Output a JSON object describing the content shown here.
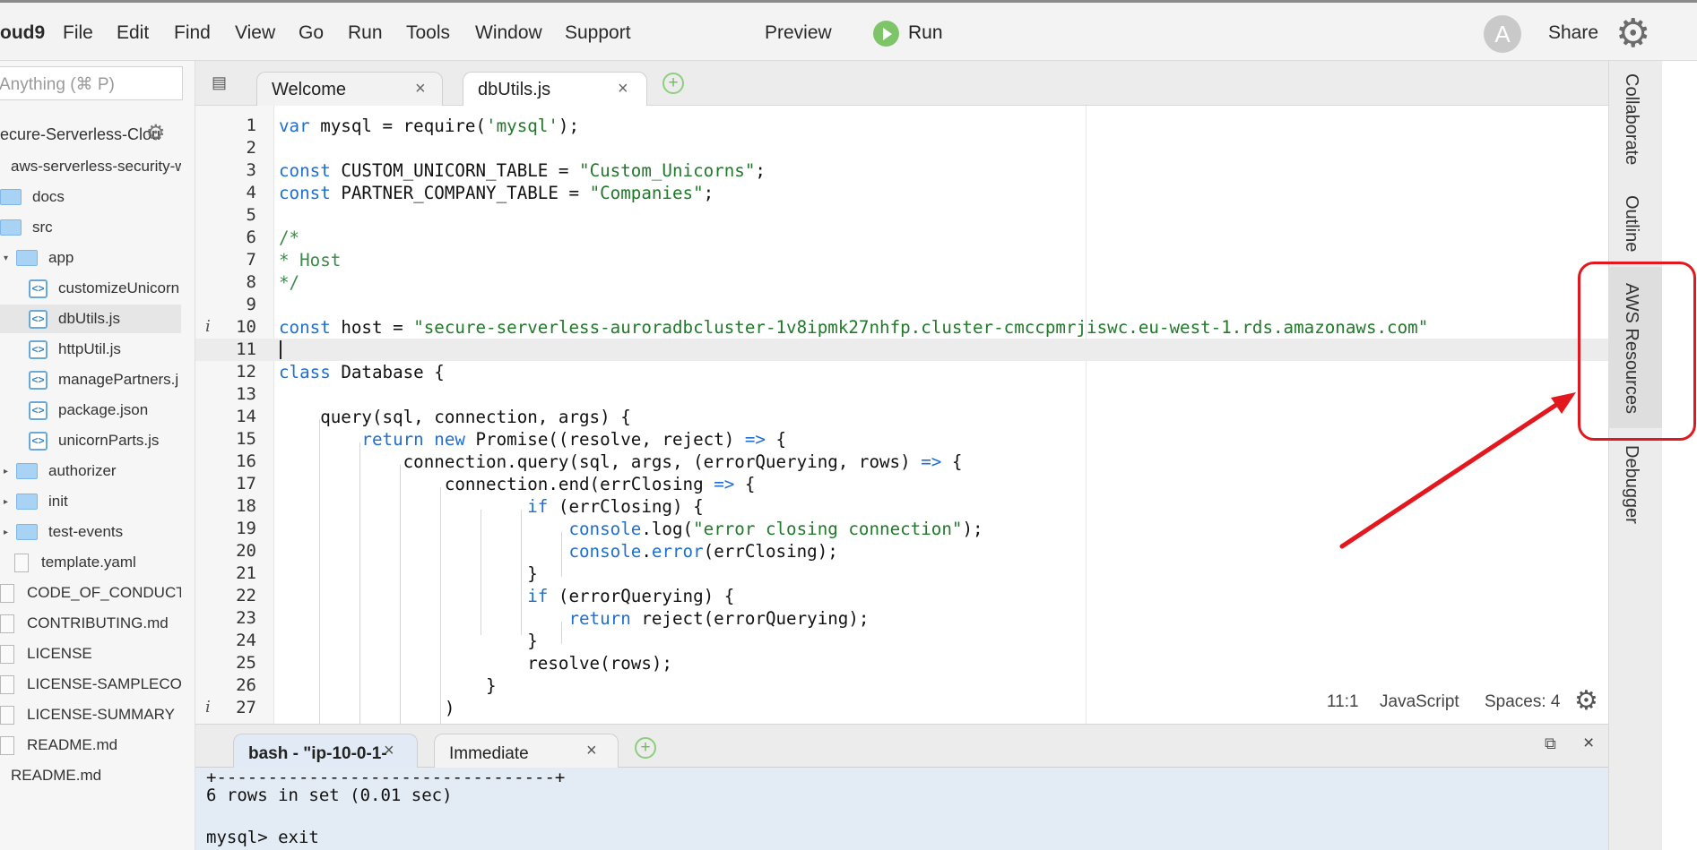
{
  "menubar": {
    "brand": "oud9",
    "items": [
      "File",
      "Edit",
      "Find",
      "View",
      "Go",
      "Run",
      "Tools",
      "Window",
      "Support"
    ],
    "preview_label": "Preview",
    "run_label": "Run",
    "avatar_letter": "A",
    "share_label": "Share"
  },
  "filetree": {
    "goto_placeholder": "Anything (⌘ P)",
    "root": "ecure-Serverless-Clou",
    "items": [
      {
        "label": "aws-serverless-security-w",
        "type": "folder-plain"
      },
      {
        "label": "docs",
        "type": "folder"
      },
      {
        "label": "src",
        "type": "folder"
      },
      {
        "label": "app",
        "type": "folder"
      },
      {
        "label": "customizeUnicorn",
        "type": "js"
      },
      {
        "label": "dbUtils.js",
        "type": "js"
      },
      {
        "label": "httpUtil.js",
        "type": "js"
      },
      {
        "label": "managePartners.j",
        "type": "js"
      },
      {
        "label": "package.json",
        "type": "js"
      },
      {
        "label": "unicornParts.js",
        "type": "js"
      },
      {
        "label": "authorizer",
        "type": "folder"
      },
      {
        "label": "init",
        "type": "folder"
      },
      {
        "label": "test-events",
        "type": "folder"
      },
      {
        "label": "template.yaml",
        "type": "doc"
      },
      {
        "label": "CODE_OF_CONDUCT.r",
        "type": "doc"
      },
      {
        "label": "CONTRIBUTING.md",
        "type": "doc"
      },
      {
        "label": "LICENSE",
        "type": "doc"
      },
      {
        "label": "LICENSE-SAMPLECODI",
        "type": "doc"
      },
      {
        "label": "LICENSE-SUMMARY",
        "type": "doc"
      },
      {
        "label": "README.md",
        "type": "doc"
      },
      {
        "label": "README.md",
        "type": "plain"
      }
    ]
  },
  "editor": {
    "tabs": [
      {
        "label": "Welcome",
        "close": "×"
      },
      {
        "label": "dbUtils.js",
        "close": "×"
      }
    ],
    "add_tab": "+",
    "info_marker": "i",
    "lines": {
      "l1": [
        "var",
        " mysql = require(",
        "'mysql'",
        ");"
      ],
      "l3": [
        "const",
        " CUSTOM_UNICORN_TABLE = ",
        "\"Custom_Unicorns\"",
        ";"
      ],
      "l4": [
        "const",
        " PARTNER_COMPANY_TABLE = ",
        "\"Companies\"",
        ";"
      ],
      "l6": "/*",
      "l7": "* Host",
      "l8": "*/",
      "l10": [
        "const",
        " host = ",
        "\"secure-serverless-auroradbcluster-1v8ipmk27nhfp.cluster-cmccpmrjiswc.eu-west-1.rds.amazonaws.com\""
      ],
      "l12": [
        "class",
        " Database {"
      ],
      "l14": "    query(sql, connection, args) {",
      "l15": [
        "        ",
        "return",
        " ",
        "new",
        " Promise((resolve, reject) ",
        "=>",
        " {"
      ],
      "l16": [
        "            connection.query(sql, args, (errorQuerying, rows) ",
        "=>",
        " {"
      ],
      "l17": [
        "                connection.end(errClosing ",
        "=>",
        " {"
      ],
      "l18": [
        "                        ",
        "if",
        " (errClosing) {"
      ],
      "l19": [
        "                            ",
        "console",
        ".log(",
        "\"error closing connection\"",
        ");"
      ],
      "l20": [
        "                            ",
        "console",
        ".",
        "error",
        "(errClosing);"
      ],
      "l21": "                        }",
      "l22": [
        "                        ",
        "if",
        " (errorQuerying) {"
      ],
      "l23": [
        "                            ",
        "return",
        " reject(errorQuerying);"
      ],
      "l24": "                        }",
      "l25": "                        resolve(rows);",
      "l26": "                    }",
      "l27": "                )"
    },
    "status": {
      "position": "11:1",
      "language": "JavaScript",
      "spaces": "Spaces: 4"
    }
  },
  "terminal": {
    "tabs": [
      {
        "label": "bash - \"ip-10-0-1-",
        "close": "×"
      },
      {
        "label": "Immediate",
        "close": "×"
      }
    ],
    "add_tab": "+",
    "close": "×",
    "lines": [
      "+---------------------------------+",
      "6 rows in set (0.01 sec)",
      "",
      "mysql> exit"
    ]
  },
  "rightpanel": {
    "tabs": [
      "Collaborate",
      "Outline",
      "AWS Resources",
      "Debugger"
    ]
  },
  "annotation": {
    "color": "#e3181e",
    "target": "AWS Resources"
  }
}
